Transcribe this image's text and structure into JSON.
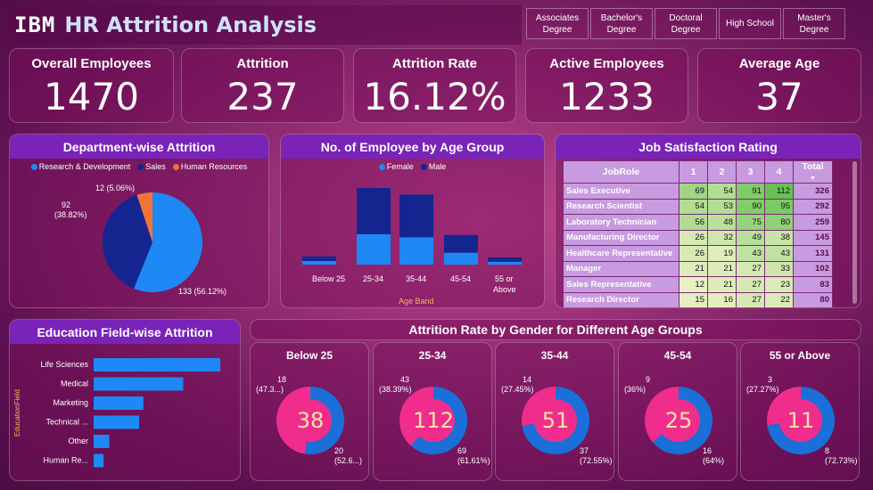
{
  "header": {
    "logo": "IBM",
    "title": "HR Attrition Analysis"
  },
  "filters": [
    "Associates Degree",
    "Bachelor's Degree",
    "Doctoral Degree",
    "High School",
    "Master's Degree"
  ],
  "kpis": [
    {
      "label": "Overall Employees",
      "value": "1470"
    },
    {
      "label": "Attrition",
      "value": "237"
    },
    {
      "label": "Attrition Rate",
      "value": "16.12%"
    },
    {
      "label": "Active Employees",
      "value": "1233"
    },
    {
      "label": "Average Age",
      "value": "37"
    }
  ],
  "dept": {
    "title": "Department-wise Attrition",
    "legend": [
      "Research & Development",
      "Sales",
      "Human Resources"
    ],
    "colors": [
      "#1e88f5",
      "#14258f",
      "#f0733a"
    ],
    "labels": [
      "133 (56.12%)",
      "92",
      "(38.82%)",
      "12 (5.06%)"
    ]
  },
  "age": {
    "title": "No. of Employee by Age Group",
    "legend": [
      "Female",
      "Male"
    ],
    "xlabel": "Age Band",
    "cats": [
      "Below 25",
      "25-34",
      "35-44",
      "45-54",
      "55 or",
      "Above"
    ]
  },
  "job": {
    "title": "Job Satisfaction Rating",
    "headers": [
      "JobRole",
      "1",
      "2",
      "3",
      "4",
      "Total"
    ],
    "rows": [
      [
        "Sales Executive",
        "69",
        "54",
        "91",
        "112",
        "326"
      ],
      [
        "Research Scientist",
        "54",
        "53",
        "90",
        "95",
        "292"
      ],
      [
        "Laboratory Technician",
        "56",
        "48",
        "75",
        "80",
        "259"
      ],
      [
        "Manufacturing Director",
        "26",
        "32",
        "49",
        "38",
        "145"
      ],
      [
        "Healthcare Representative",
        "26",
        "19",
        "43",
        "43",
        "131"
      ],
      [
        "Manager",
        "21",
        "21",
        "27",
        "33",
        "102"
      ],
      [
        "Sales Representative",
        "12",
        "21",
        "27",
        "23",
        "83"
      ],
      [
        "Research Director",
        "15",
        "16",
        "27",
        "22",
        "80"
      ]
    ]
  },
  "edu": {
    "title": "Education Field-wise Attrition",
    "ylabel": "EducationField",
    "labels": [
      "Life Sciences",
      "Medical",
      "Marketing",
      "Technical ...",
      "Other",
      "Human Re..."
    ]
  },
  "gender": {
    "title": "Attrition Rate by Gender for Different Age Groups",
    "groups": [
      {
        "title": "Below 25",
        "center": "38",
        "top_n": "18",
        "top_p": "(47.3...)",
        "bot_n": "20",
        "bot_p": "(52.6...)"
      },
      {
        "title": "25-34",
        "center": "112",
        "top_n": "43",
        "top_p": "(38.39%)",
        "bot_n": "69",
        "bot_p": "(61.61%)"
      },
      {
        "title": "35-44",
        "center": "51",
        "top_n": "14",
        "top_p": "(27.45%)",
        "bot_n": "37",
        "bot_p": "(72.55%)"
      },
      {
        "title": "45-54",
        "center": "25",
        "top_n": "9",
        "top_p": "(36%)",
        "bot_n": "16",
        "bot_p": "(64%)"
      },
      {
        "title": "55 or Above",
        "center": "11",
        "top_n": "3",
        "top_p": "(27.27%)",
        "bot_n": "8",
        "bot_p": "(72.73%)"
      }
    ]
  },
  "chart_data": [
    {
      "type": "pie",
      "title": "Department-wise Attrition",
      "categories": [
        "Research & Development",
        "Sales",
        "Human Resources"
      ],
      "values": [
        133,
        92,
        12
      ],
      "percent": [
        56.12,
        38.82,
        5.06
      ]
    },
    {
      "type": "bar",
      "title": "No. of Employee by Age Group",
      "xlabel": "Age Band",
      "categories": [
        "Below 25",
        "25-34",
        "35-44",
        "45-54",
        "55 or Above"
      ],
      "series": [
        {
          "name": "Female",
          "values": [
            15,
            128,
            115,
            50,
            12
          ]
        },
        {
          "name": "Male",
          "values": [
            20,
            195,
            180,
            75,
            18
          ]
        }
      ]
    },
    {
      "type": "bar",
      "title": "Education Field-wise Attrition",
      "ylabel": "EducationField",
      "categories": [
        "Life Sciences",
        "Medical",
        "Marketing",
        "Technical ...",
        "Other",
        "Human Re..."
      ],
      "values": [
        89,
        63,
        35,
        32,
        11,
        7
      ]
    },
    {
      "type": "pie",
      "title": "Attrition Rate by Gender for Different Age Groups",
      "categories": [
        "Below 25",
        "25-34",
        "35-44",
        "45-54",
        "55 or Above"
      ],
      "series": [
        {
          "values": [
            18,
            43,
            14,
            9,
            3
          ]
        },
        {
          "values": [
            20,
            69,
            37,
            16,
            8
          ]
        }
      ]
    }
  ]
}
